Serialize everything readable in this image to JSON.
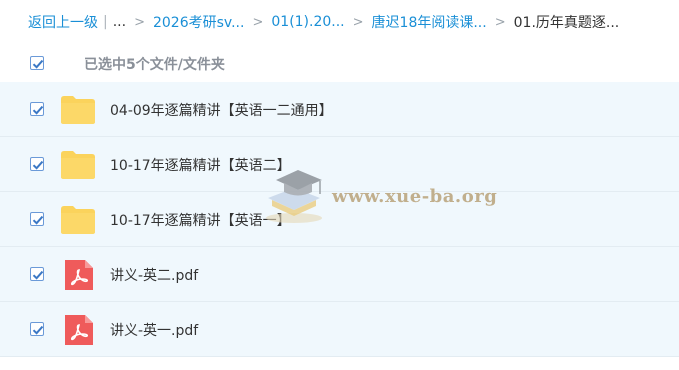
{
  "breadcrumb": {
    "back_label": "返回上一级",
    "separator": "|",
    "ellipsis": "...",
    "arrow": ">",
    "items": [
      "2026考研sv...",
      "01(1).20...",
      "唐迟18年阅读课...",
      "01.历年真题逐..."
    ]
  },
  "selection": {
    "label": "已选中5个文件/文件夹",
    "checked": true
  },
  "files": [
    {
      "name": "04-09年逐篇精讲【英语一二通用】",
      "type": "folder",
      "checked": true
    },
    {
      "name": "10-17年逐篇精讲【英语二】",
      "type": "folder",
      "checked": true
    },
    {
      "name": "10-17年逐篇精讲【英语一】",
      "type": "folder",
      "checked": true
    },
    {
      "name": "讲义-英二.pdf",
      "type": "pdf",
      "checked": true
    },
    {
      "name": "讲义-英一.pdf",
      "type": "pdf",
      "checked": true
    }
  ],
  "watermark": {
    "text": "www.xue-ba.org"
  },
  "colors": {
    "link": "#1a8fd6",
    "row_bg": "#f0f8fd",
    "folder": "#fbd35c",
    "pdf": "#ef5b5b",
    "checkbox_border": "#6b9ad8",
    "checkmark": "#3b78c5"
  },
  "icons": {
    "folder": "folder-icon",
    "pdf": "pdf-icon",
    "check": "checkmark-icon"
  }
}
